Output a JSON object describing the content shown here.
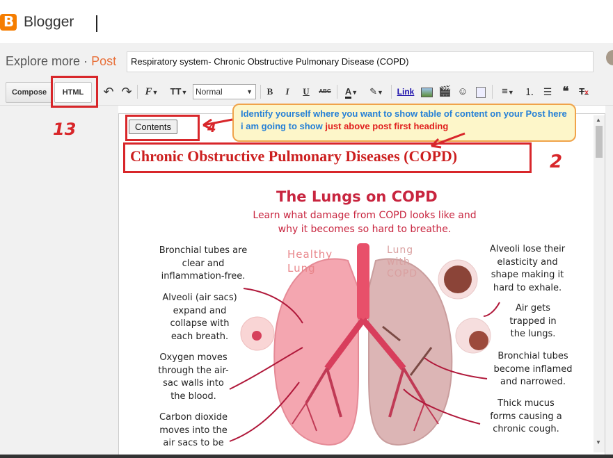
{
  "app": {
    "brand": "Blogger",
    "logo_letter": "B"
  },
  "header": {
    "explore_label": "Explore more",
    "separator": "·",
    "post_label": "Post",
    "post_title": "Respiratory system- Chronic Obstructive Pulmonary Disease (COPD)"
  },
  "toolbar": {
    "compose_label": "Compose",
    "html_label": "HTML",
    "undo_icon": "↶",
    "redo_icon": "↷",
    "font_icon": "F",
    "size_icon": "TT",
    "format_value": "Normal",
    "bold": "B",
    "italic": "I",
    "underline": "U",
    "strike": "ABC",
    "text_color": "A",
    "link_label": "Link",
    "quote": "❝",
    "clear": "T"
  },
  "editor": {
    "contents_button": "Contents",
    "heading": "Chronic Obstructive Pulmonary Diseases (COPD)"
  },
  "annotation": {
    "callout_text": "Identify yourself where you want to show table of content on your Post here i am going to show ",
    "callout_highlight": "just above post first heading",
    "num_html": "3",
    "num_contents": "4",
    "num_heading": "2",
    "colors": {
      "box": "#d8262a",
      "callout_bg": "#fdf6c9",
      "callout_text": "#2680d6"
    }
  },
  "infographic": {
    "title": "The Lungs on COPD",
    "subtitle": "Learn what damage from COPD looks like and why it becomes so hard to breathe.",
    "healthy_label": "Healthy Lung",
    "copd_label": "Lung with COPD",
    "left_1": "Bronchial tubes are clear and inflammation-free.",
    "left_2": "Alveoli (air sacs) expand and collapse with each breath.",
    "left_3": "Oxygen moves through the air-sac walls into the blood.",
    "left_4": "Carbon dioxide moves into the air sacs to be",
    "right_1": "Alveoli lose their elasticity and shape making it hard to exhale.",
    "right_2": "Air gets trapped in the lungs.",
    "right_3": "Bronchial tubes become inflamed and narrowed.",
    "right_4": "Thick mucus forms causing a chronic cough."
  }
}
